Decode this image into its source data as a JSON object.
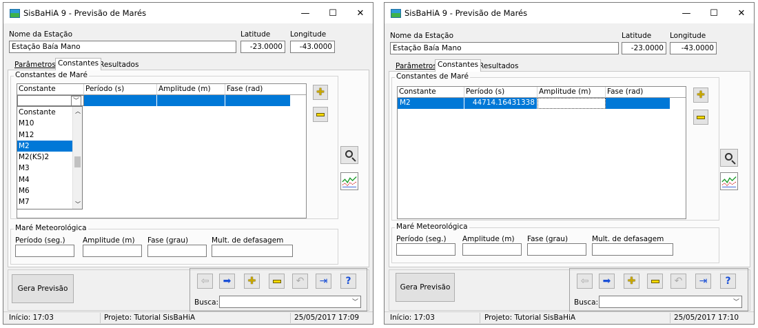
{
  "colors": {
    "selection": "#0078d7",
    "accent_yellow": "#f5d800",
    "arrow_blue": "#1a4fd6"
  },
  "icons": {
    "app": "sisbahia-icon",
    "add": "plus-icon",
    "remove": "minus-icon",
    "search": "magnifier-icon",
    "chart": "tide-chart-icon",
    "prev": "arrow-left-icon",
    "next": "arrow-right-icon",
    "undo": "undo-icon",
    "exit": "exit-door-icon",
    "help": "help-icon"
  },
  "windows": [
    {
      "title": "SisBaHiA 9 - Previsão de Marés",
      "controls": {
        "min": "—",
        "max": "☐",
        "close": "✕"
      },
      "station": {
        "name_label": "Nome da Estação",
        "name_value": "Estação Baía Mano",
        "lat_label": "Latitude",
        "lat_value": "-23.0000",
        "lon_label": "Longitude",
        "lon_value": "-43.0000"
      },
      "tabs": [
        "Parâmetros",
        "Constantes",
        "Resultados"
      ],
      "constants": {
        "group_label": "Constantes de Maré",
        "headers": [
          "Constante",
          "Período (s)",
          "Amplitude (m)",
          "Fase (rad)"
        ],
        "row": [
          "",
          "",
          "",
          ""
        ],
        "dropdown": [
          "Constante",
          "M10",
          "M12",
          "M2",
          "M2(KS)2",
          "M3",
          "M4",
          "M6",
          "M7"
        ],
        "dropdown_selected": "M2"
      },
      "meteo": {
        "group_label": "Maré Meteorológica",
        "labels": [
          "Período (seg.)",
          "Amplitude (m)",
          "Fase (grau)",
          "Mult. de defasagem"
        ]
      },
      "generate_label": "Gera Previsão",
      "search_label": "Busca:",
      "status": {
        "start": "Início: 17:03",
        "project": "Projeto: Tutorial SisBaHiA",
        "datetime": "25/05/2017 17:09"
      }
    },
    {
      "title": "SisBaHiA 9 - Previsão de Marés",
      "controls": {
        "min": "—",
        "max": "☐",
        "close": "✕"
      },
      "station": {
        "name_label": "Nome da Estação",
        "name_value": "Estação Baía Mano",
        "lat_label": "Latitude",
        "lat_value": "-23.0000",
        "lon_label": "Longitude",
        "lon_value": "-43.0000"
      },
      "tabs": [
        "Parâmetros",
        "Constantes",
        "Resultados"
      ],
      "constants": {
        "group_label": "Constantes de Maré",
        "headers": [
          "Constante",
          "Período (s)",
          "Amplitude (m)",
          "Fase (rad)"
        ],
        "row": [
          "M2",
          "44714.16431338",
          "",
          ""
        ]
      },
      "meteo": {
        "group_label": "Maré Meteorológica",
        "labels": [
          "Período (seg.)",
          "Amplitude (m)",
          "Fase (grau)",
          "Mult. de defasagem"
        ]
      },
      "generate_label": "Gera Previsão",
      "search_label": "Busca:",
      "status": {
        "start": "Início: 17:03",
        "project": "Projeto: Tutorial SisBaHiA",
        "datetime": "25/05/2017 17:10"
      }
    }
  ]
}
